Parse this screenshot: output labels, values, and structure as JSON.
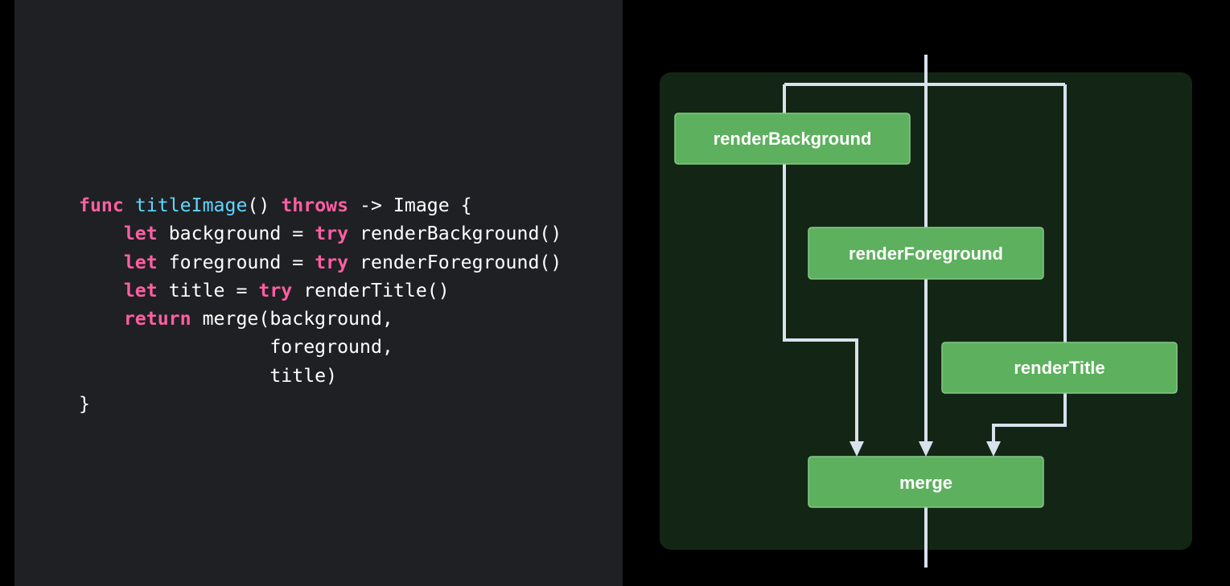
{
  "code": {
    "lines": [
      [
        {
          "t": "kw",
          "v": "func"
        },
        {
          "t": "plain",
          "v": " "
        },
        {
          "t": "fn",
          "v": "titleImage"
        },
        {
          "t": "plain",
          "v": "() "
        },
        {
          "t": "kw",
          "v": "throws"
        },
        {
          "t": "plain",
          "v": " -> Image {"
        }
      ],
      [
        {
          "t": "plain",
          "v": "    "
        },
        {
          "t": "kw",
          "v": "let"
        },
        {
          "t": "plain",
          "v": " background = "
        },
        {
          "t": "kw",
          "v": "try"
        },
        {
          "t": "plain",
          "v": " renderBackground()"
        }
      ],
      [
        {
          "t": "plain",
          "v": "    "
        },
        {
          "t": "kw",
          "v": "let"
        },
        {
          "t": "plain",
          "v": " foreground = "
        },
        {
          "t": "kw",
          "v": "try"
        },
        {
          "t": "plain",
          "v": " renderForeground()"
        }
      ],
      [
        {
          "t": "plain",
          "v": "    "
        },
        {
          "t": "kw",
          "v": "let"
        },
        {
          "t": "plain",
          "v": " title = "
        },
        {
          "t": "kw",
          "v": "try"
        },
        {
          "t": "plain",
          "v": " renderTitle()"
        }
      ],
      [
        {
          "t": "plain",
          "v": "    "
        },
        {
          "t": "kw",
          "v": "return"
        },
        {
          "t": "plain",
          "v": " merge(background,"
        }
      ],
      [
        {
          "t": "plain",
          "v": "                 foreground,"
        }
      ],
      [
        {
          "t": "plain",
          "v": "                 title)"
        }
      ],
      [
        {
          "t": "plain",
          "v": "}"
        }
      ]
    ]
  },
  "diagram": {
    "nodes": {
      "render_background": "renderBackground",
      "render_foreground": "renderForeground",
      "render_title": "renderTitle",
      "merge": "merge"
    }
  },
  "colors": {
    "keyword": "#fc5fa3",
    "function_name": "#5dd8ff",
    "plain_text": "#ffffff",
    "code_background": "#1f2023",
    "page_background": "#000000",
    "diagram_background": "#132615",
    "node_fill": "#5db05e",
    "node_border": "#84c985",
    "edge": "#d8e1ec"
  }
}
